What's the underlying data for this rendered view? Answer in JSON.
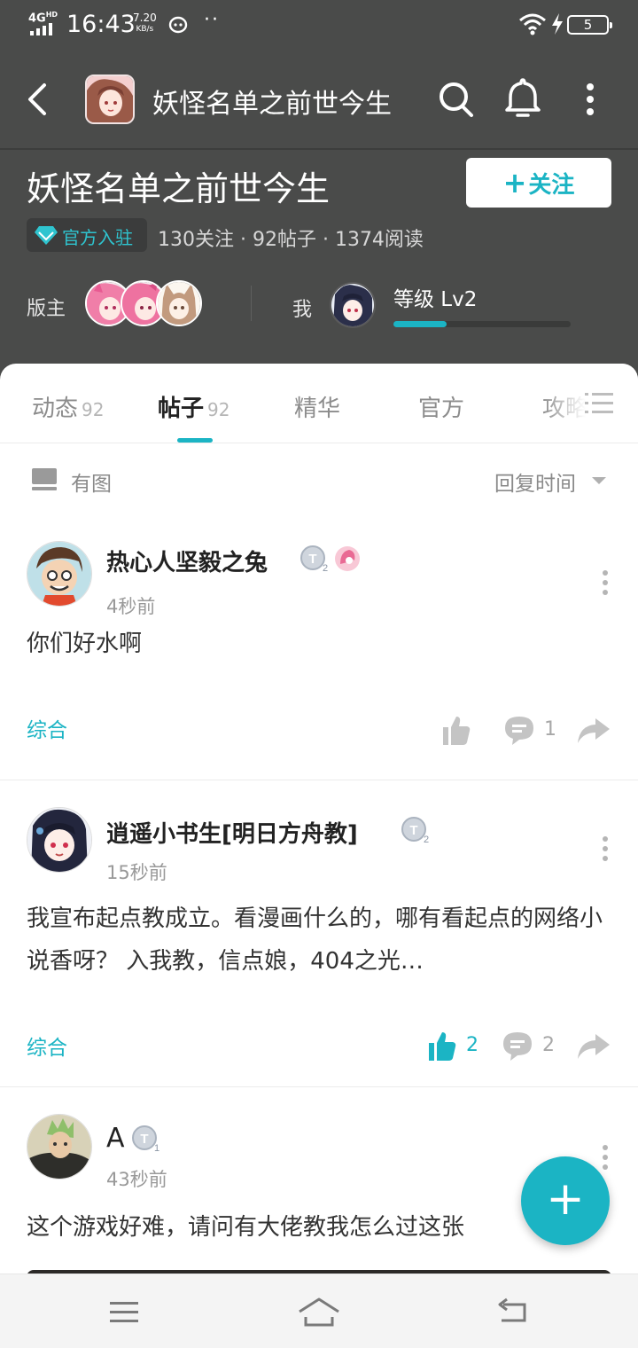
{
  "status_bar": {
    "network": "4G",
    "network_sup": "HD",
    "time": "16:43",
    "speed_value": "7.20",
    "speed_unit": "KB/s",
    "battery": "5"
  },
  "nav": {
    "title": "妖怪名单之前世今生",
    "icons": [
      "back-icon",
      "search-icon",
      "bell-icon",
      "more-vertical-icon"
    ]
  },
  "forum": {
    "name": "妖怪名单之前世今生",
    "follow_plus": "+",
    "follow_label": "关注",
    "official_label": "官方入驻",
    "stats": "130关注 · 92帖子 · 1374阅读",
    "moderator_label": "版主",
    "me_label": "我",
    "level_label": "等级 Lv2",
    "level_progress": 0.3
  },
  "tabs": [
    {
      "label": "动态",
      "count": "92"
    },
    {
      "label": "帖子",
      "count": "92"
    },
    {
      "label": "精华",
      "count": ""
    },
    {
      "label": "官方",
      "count": ""
    },
    {
      "label": "攻略",
      "count": ""
    }
  ],
  "filter": {
    "with_image_label": "有图",
    "sort_label": "回复时间"
  },
  "posts": [
    {
      "user": "热心人坚毅之兔",
      "time": "4秒前",
      "text": "你们好水啊",
      "tag": "综合",
      "likes": "",
      "comments": "1",
      "liked": false
    },
    {
      "user": "逍遥小书生[明日方舟教]",
      "time": "15秒前",
      "text": "我宣布起点教成立。看漫画什么的，哪有看起点的网络小说香呀？ 入我教，信点娘，404之光…",
      "tag": "综合",
      "likes": "2",
      "comments": "2",
      "liked": true
    },
    {
      "user": "A",
      "time": "43秒前",
      "text": "这个游戏好难，请问有大佬教我怎么过这张"
    }
  ],
  "fab": {
    "label": "+"
  },
  "colors": {
    "accent": "#1bb4c4",
    "header_bg": "#4a4b4a",
    "text_primary": "#222222",
    "text_secondary": "#999999"
  }
}
